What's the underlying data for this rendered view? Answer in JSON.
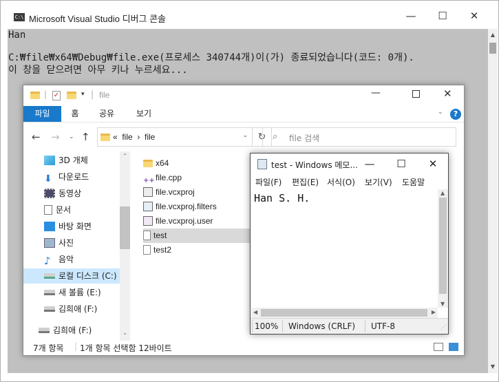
{
  "console": {
    "title": "Microsoft Visual Studio 디버그 콘솔",
    "icon": "C:\\",
    "lines": [
      "Han",
      "",
      "C:₩file₩x64₩Debug₩file.exe(프로세스 340744개)이(가) 종료되었습니다(코드: 0개).",
      "이 창을 닫으려면 아무 키나 누르세요..."
    ],
    "controls": {
      "minimize": "—",
      "maximize": "☐",
      "close": "✕"
    }
  },
  "explorer": {
    "title": "file",
    "tabs": [
      "파일",
      "홈",
      "공유",
      "보기"
    ],
    "active_tab": "파일",
    "breadcrumb": "«  file  ›  file",
    "search_placeholder": "file 검색",
    "nav_items": [
      {
        "label": "3D 개체",
        "icon": "cube-icon"
      },
      {
        "label": "다운로드",
        "icon": "download-icon"
      },
      {
        "label": "동영상",
        "icon": "video-icon"
      },
      {
        "label": "문서",
        "icon": "document-icon"
      },
      {
        "label": "바탕 화면",
        "icon": "desktop-icon"
      },
      {
        "label": "사진",
        "icon": "picture-icon"
      },
      {
        "label": "음악",
        "icon": "music-icon"
      },
      {
        "label": "로컬 디스크 (C:)",
        "icon": "drive-icon"
      },
      {
        "label": "새 볼륨 (E:)",
        "icon": "drive-icon"
      },
      {
        "label": "김희애 (F:)",
        "icon": "drive-icon"
      },
      {
        "label": "김희애 (F:)",
        "icon": "usb-drive-icon"
      }
    ],
    "files": [
      {
        "name": "x64",
        "icon": "folder-icon"
      },
      {
        "name": "file.cpp",
        "icon": "cpp-file-icon"
      },
      {
        "name": "file.vcxproj",
        "icon": "project-file-icon"
      },
      {
        "name": "file.vcxproj.filters",
        "icon": "filters-file-icon"
      },
      {
        "name": "file.vcxproj.user",
        "icon": "user-file-icon"
      },
      {
        "name": "test",
        "icon": "text-file-icon"
      },
      {
        "name": "test2",
        "icon": "text-file-icon"
      }
    ],
    "status": {
      "count": "7개 항목",
      "selection": "1개 항목 선택함 12바이트"
    }
  },
  "notepad": {
    "title": "test - Windows 메모...",
    "menus": [
      "파일(F)",
      "편집(E)",
      "서식(O)",
      "보기(V)",
      "도움말"
    ],
    "content": "Han S. H.",
    "status": {
      "zoom": "100%",
      "line_ending": "Windows (CRLF)",
      "encoding": "UTF-8"
    }
  },
  "colors": {
    "accent": "#1979ca",
    "console_bg": "#c0c0c0",
    "selection": "#cce8ff"
  }
}
